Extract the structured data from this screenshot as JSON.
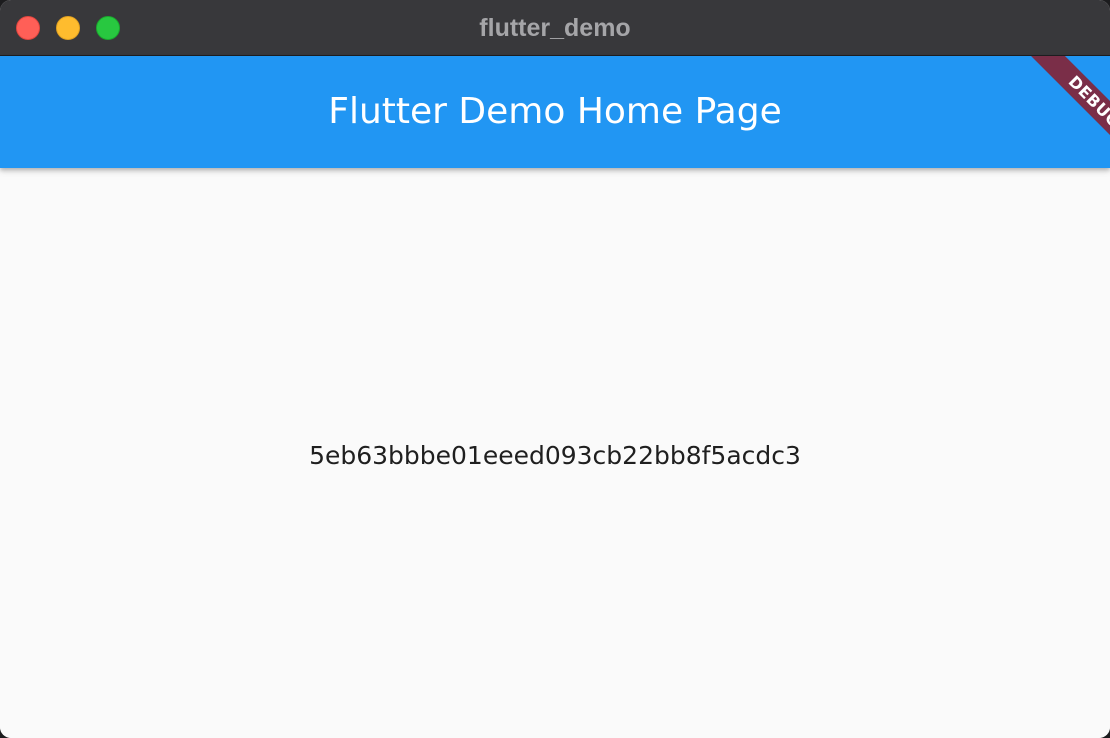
{
  "window": {
    "title": "flutter_demo",
    "controls": {
      "close_color": "#ff5f57",
      "minimize_color": "#febc2e",
      "zoom_color": "#28c840"
    }
  },
  "appbar": {
    "title": "Flutter Demo Home Page",
    "color": "#2196f3"
  },
  "debug_banner": {
    "label": "DEBUG",
    "color": "#7a2e48"
  },
  "body": {
    "text": "5eb63bbbe01eeed093cb22bb8f5acdc3"
  }
}
